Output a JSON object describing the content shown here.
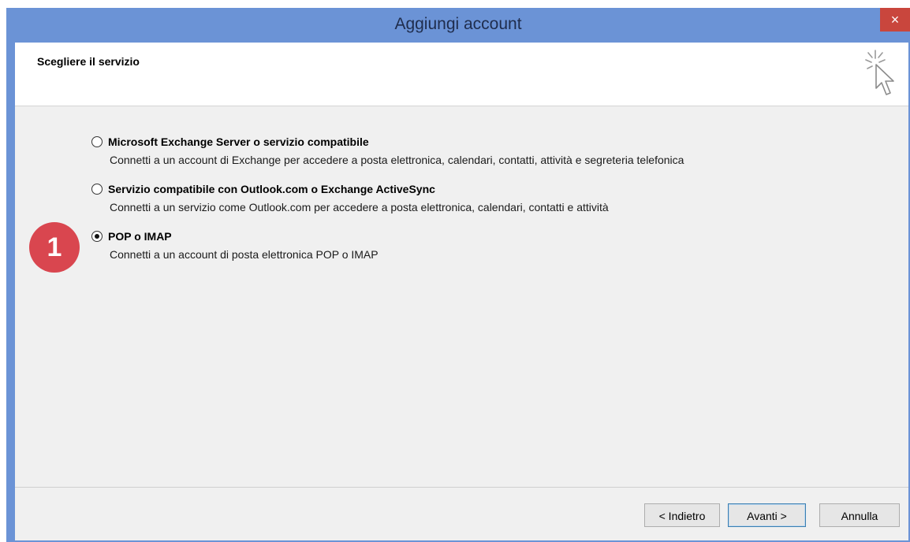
{
  "window": {
    "title": "Aggiungi account",
    "close_label": "×"
  },
  "header": {
    "title": "Scegliere il servizio",
    "icon": "wizard-cursor-icon"
  },
  "options": [
    {
      "label": "Microsoft Exchange Server o servizio compatibile",
      "description": "Connetti a un account di Exchange per accedere a posta elettronica, calendari, contatti, attività e segreteria telefonica",
      "selected": false
    },
    {
      "label": "Servizio compatibile con Outlook.com o Exchange ActiveSync",
      "description": "Connetti a un servizio come Outlook.com per accedere a posta elettronica, calendari, contatti e attività",
      "selected": false
    },
    {
      "label": "POP o IMAP",
      "description": "Connetti a un account di posta elettronica POP o IMAP",
      "selected": true
    }
  ],
  "step_badge": "1",
  "buttons": {
    "back": "< Indietro",
    "next": "Avanti >",
    "cancel": "Annulla"
  },
  "colors": {
    "titlebar": "#6b93d6",
    "close": "#c9463d",
    "badge": "#d9464f"
  }
}
